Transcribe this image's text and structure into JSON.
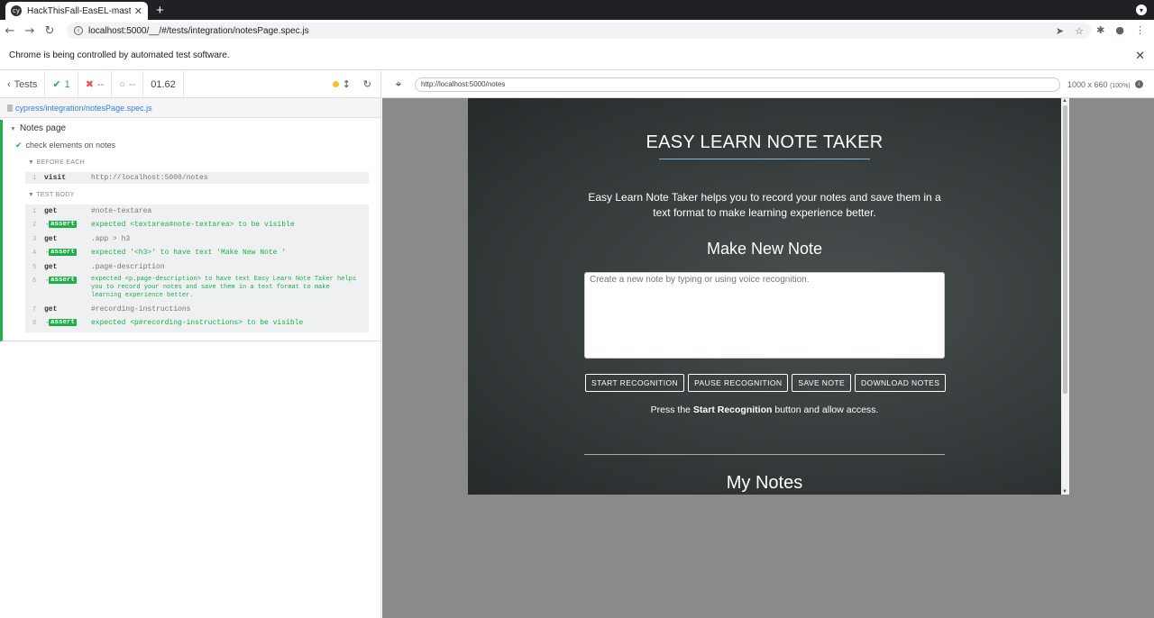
{
  "browser": {
    "tab_title": "HackThisFall-EasEL-master-ba",
    "tab_favicon": "cy",
    "address": "localhost:5000/__/#/tests/integration/notesPage.spec.js",
    "infobar_text": "Chrome is being controlled by automated test software."
  },
  "runner": {
    "tests_label": "Tests",
    "passed": "1",
    "failed": "--",
    "pending": "--",
    "duration": "01.62",
    "spec_path": "cypress/integration/notesPage.spec.js",
    "suite_title": "Notes page",
    "test_title": "check elements on notes",
    "before_each_label": "BEFORE EACH",
    "test_body_label": "TEST BODY",
    "before_each_cmd": {
      "n": "1",
      "name": "visit",
      "msg": "http://localhost:5000/notes"
    },
    "commands": [
      {
        "n": "1",
        "name": "get",
        "msg": "#note-textarea"
      },
      {
        "n": "2",
        "assert": "assert",
        "msg": "expected <textarea#note-textarea> to be visible"
      },
      {
        "n": "3",
        "name": "get",
        "msg": ".app > h3"
      },
      {
        "n": "4",
        "assert": "assert",
        "msg": "expected '<h3>' to have text 'Make New Note '"
      },
      {
        "n": "5",
        "name": "get",
        "msg": ".page-description"
      },
      {
        "n": "6",
        "assert": "assert",
        "msg": "expected <p.page-description> to have text Easy Learn Note Taker helps you to record your notes and save them in a text format to make learning experience better."
      },
      {
        "n": "7",
        "name": "get",
        "msg": "#recording-instructions"
      },
      {
        "n": "8",
        "assert": "assert",
        "msg": "expected <p#recording-instructions> to be visible"
      }
    ]
  },
  "preview": {
    "url": "http://localhost:5000/notes",
    "viewport": "1000 x 660",
    "zoom": "(100%)"
  },
  "app": {
    "title": "EASY LEARN NOTE TAKER",
    "description": "Easy Learn Note Taker helps you to record your notes and save them in a text format to make learning experience better.",
    "make_new_note": "Make New Note",
    "textarea_placeholder": "Create a new note by typing or using voice recognition.",
    "buttons": {
      "start": "START RECOGNITION",
      "pause": "PAUSE RECOGNITION",
      "save": "SAVE NOTE",
      "download": "DOWNLOAD NOTES"
    },
    "instr_pre": "Press the",
    "instr_bold": "Start Recognition",
    "instr_post": "button and allow access.",
    "my_notes": "My Notes"
  }
}
